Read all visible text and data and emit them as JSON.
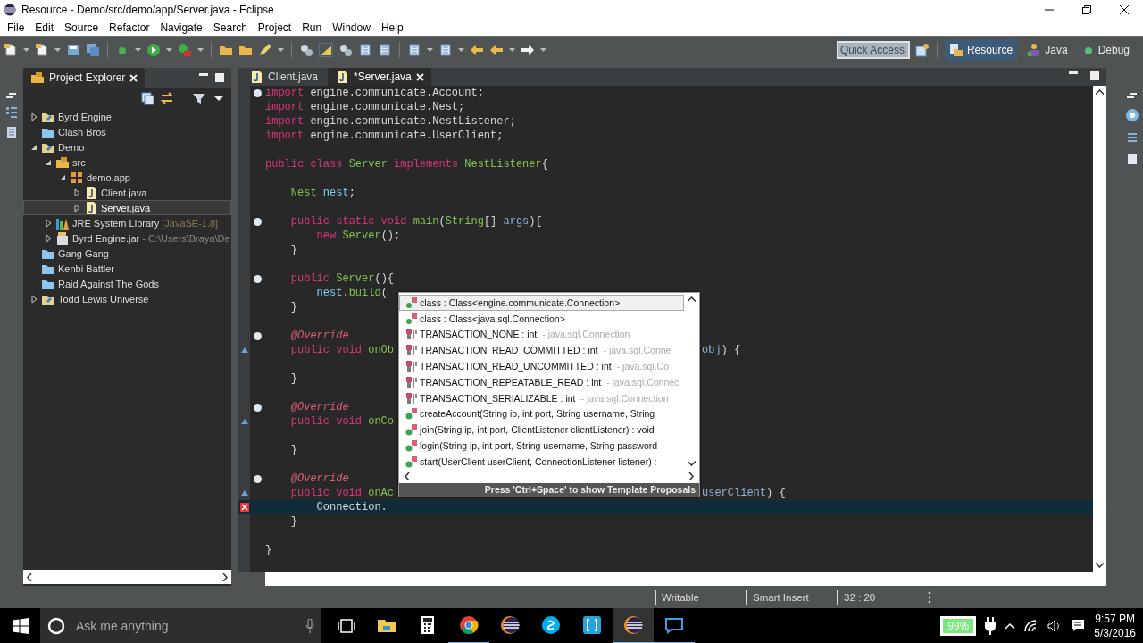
{
  "window": {
    "title": "Resource - Demo/src/demo/app/Server.java - Eclipse"
  },
  "menu": [
    "File",
    "Edit",
    "Source",
    "Refactor",
    "Navigate",
    "Search",
    "Project",
    "Run",
    "Window",
    "Help"
  ],
  "toolbar": {
    "quick_access": {
      "placeholder": "Quick Access"
    },
    "perspectives": [
      {
        "label": "Resource",
        "kind": "resource",
        "selected": true
      },
      {
        "label": "Java",
        "kind": "java",
        "selected": false
      },
      {
        "label": "Debug",
        "kind": "debug",
        "selected": false
      }
    ]
  },
  "project_explorer": {
    "title": "Project Explorer",
    "tree": [
      {
        "label": "Byrd Engine",
        "kind": "project",
        "expanded": false,
        "selected": false
      },
      {
        "label": "Clash Bros",
        "kind": "closed-project",
        "selected": false
      },
      {
        "label": "Demo",
        "kind": "project",
        "expanded": true,
        "selected": false,
        "children": [
          {
            "label": "src",
            "kind": "source-folder",
            "expanded": true,
            "selected": false,
            "children": [
              {
                "label": "demo.app",
                "kind": "package",
                "expanded": true,
                "selected": false,
                "children": [
                  {
                    "label": "Client.java",
                    "kind": "java",
                    "expanded": false,
                    "selected": false
                  },
                  {
                    "label": "Server.java",
                    "kind": "java",
                    "expanded": false,
                    "selected": true
                  }
                ]
              }
            ]
          },
          {
            "label": "JRE System Library",
            "decoration": "[JavaSE-1.8]",
            "kind": "library",
            "expanded": false,
            "selected": false
          },
          {
            "label": "Byrd Engine.jar",
            "decoration": "- C:\\Users\\Braya\\De",
            "kind": "jar",
            "expanded": false,
            "selected": false
          }
        ]
      },
      {
        "label": "Gang Gang",
        "kind": "closed-project",
        "selected": false
      },
      {
        "label": "Kenbi Battler",
        "kind": "closed-project",
        "selected": false
      },
      {
        "label": "Raid Against The Gods",
        "kind": "closed-project",
        "selected": false
      },
      {
        "label": "Todd Lewis Universe",
        "kind": "project",
        "expanded": false,
        "selected": false
      }
    ]
  },
  "editor": {
    "tabs": [
      {
        "label": "Client.java",
        "selected": false
      },
      {
        "label": "*Server.java",
        "selected": true
      }
    ],
    "lines": [
      {
        "kind": "code",
        "fold": true,
        "tokens": [
          {
            "kind": "kw",
            "text": "import"
          },
          {
            "kind": "plain",
            "text": " engine.communicate.Account;"
          }
        ]
      },
      {
        "kind": "code",
        "tokens": [
          {
            "kind": "kw",
            "text": "import"
          },
          {
            "kind": "plain",
            "text": " engine.communicate.Nest;"
          }
        ]
      },
      {
        "kind": "code",
        "tokens": [
          {
            "kind": "kw",
            "text": "import"
          },
          {
            "kind": "plain",
            "text": " engine.communicate.NestListener;"
          }
        ]
      },
      {
        "kind": "code",
        "tokens": [
          {
            "kind": "kw",
            "text": "import"
          },
          {
            "kind": "plain",
            "text": " engine.communicate.UserClient;"
          }
        ]
      },
      {
        "kind": "blank"
      },
      {
        "kind": "code",
        "tokens": [
          {
            "kind": "kw",
            "text": "public class "
          },
          {
            "kind": "type",
            "text": "Server"
          },
          {
            "kind": "kw",
            "text": " implements "
          },
          {
            "kind": "type",
            "text": "NestListener"
          },
          {
            "kind": "plain",
            "text": "{"
          }
        ]
      },
      {
        "kind": "blank"
      },
      {
        "kind": "code",
        "tokens": [
          {
            "kind": "type",
            "text": "    Nest"
          },
          {
            "kind": "field",
            "text": " nest"
          },
          {
            "kind": "plain",
            "text": ";"
          }
        ]
      },
      {
        "kind": "blank"
      },
      {
        "kind": "code",
        "fold": true,
        "tokens": [
          {
            "kind": "kw",
            "text": "    public static void "
          },
          {
            "kind": "method",
            "text": "main"
          },
          {
            "kind": "plain",
            "text": "("
          },
          {
            "kind": "type",
            "text": "String"
          },
          {
            "kind": "plain",
            "text": "[] "
          },
          {
            "kind": "param",
            "text": "args"
          },
          {
            "kind": "plain",
            "text": "){"
          }
        ]
      },
      {
        "kind": "code",
        "tokens": [
          {
            "kind": "kw",
            "text": "        new "
          },
          {
            "kind": "type",
            "text": "Server"
          },
          {
            "kind": "plain",
            "text": "();"
          }
        ]
      },
      {
        "kind": "code",
        "tokens": [
          {
            "kind": "plain",
            "text": "    }"
          }
        ]
      },
      {
        "kind": "blank"
      },
      {
        "kind": "code",
        "fold": true,
        "tokens": [
          {
            "kind": "kw",
            "text": "    public "
          },
          {
            "kind": "method",
            "text": "Server"
          },
          {
            "kind": "plain",
            "text": "(){"
          }
        ]
      },
      {
        "kind": "code",
        "tokens": [
          {
            "kind": "field",
            "text": "        nest"
          },
          {
            "kind": "plain",
            "text": "."
          },
          {
            "kind": "method",
            "text": "build"
          },
          {
            "kind": "plain",
            "text": "("
          }
        ]
      },
      {
        "kind": "code",
        "tokens": [
          {
            "kind": "plain",
            "text": "    }"
          }
        ]
      },
      {
        "kind": "blank"
      },
      {
        "kind": "code",
        "fold": true,
        "tokens": [
          {
            "kind": "ann",
            "text": "    @Override"
          }
        ]
      },
      {
        "kind": "code",
        "override_marker": true,
        "tokens": [
          {
            "kind": "kw",
            "text": "    public void "
          },
          {
            "kind": "method",
            "text": "onOb"
          }
        ],
        "tail": [
          {
            "kind": "param",
            "text": "obj"
          },
          {
            "kind": "plain",
            "text": ") {"
          }
        ]
      },
      {
        "kind": "blank"
      },
      {
        "kind": "code",
        "tokens": [
          {
            "kind": "plain",
            "text": "    }"
          }
        ]
      },
      {
        "kind": "blank"
      },
      {
        "kind": "code",
        "fold": true,
        "tokens": [
          {
            "kind": "ann",
            "text": "    @Override"
          }
        ]
      },
      {
        "kind": "code",
        "override_marker": true,
        "tokens": [
          {
            "kind": "kw",
            "text": "    public void "
          },
          {
            "kind": "method",
            "text": "onCo"
          }
        ]
      },
      {
        "kind": "blank"
      },
      {
        "kind": "code",
        "tokens": [
          {
            "kind": "plain",
            "text": "    }"
          }
        ]
      },
      {
        "kind": "blank"
      },
      {
        "kind": "code",
        "fold": true,
        "tokens": [
          {
            "kind": "ann",
            "text": "    @Override"
          }
        ]
      },
      {
        "kind": "code",
        "override_marker": true,
        "tokens": [
          {
            "kind": "kw",
            "text": "    public void "
          },
          {
            "kind": "method",
            "text": "onAc"
          }
        ],
        "tail": [
          {
            "kind": "param",
            "text": "userClient"
          },
          {
            "kind": "plain",
            "text": ") {"
          }
        ]
      },
      {
        "kind": "code",
        "error_marker": true,
        "current": true,
        "tokens": [
          {
            "kind": "plain",
            "text": "        Connection."
          }
        ]
      },
      {
        "kind": "code",
        "tokens": [
          {
            "kind": "plain",
            "text": "    }"
          }
        ]
      },
      {
        "kind": "blank"
      },
      {
        "kind": "code",
        "tokens": [
          {
            "kind": "plain",
            "text": "}"
          }
        ]
      }
    ],
    "autocomplete": {
      "items": [
        {
          "kind": "class-literal",
          "text": "class : Class<engine.communicate.Connection>",
          "selected": true
        },
        {
          "kind": "class-literal",
          "text": "class : Class<java.sql.Connection>",
          "selected": false
        },
        {
          "kind": "constant",
          "text": "TRANSACTION_NONE : int",
          "detail": "- java.sql.Connection",
          "selected": false
        },
        {
          "kind": "constant",
          "text": "TRANSACTION_READ_COMMITTED : int",
          "detail": "- java.sql.Conne",
          "selected": false
        },
        {
          "kind": "constant",
          "text": "TRANSACTION_READ_UNCOMMITTED : int",
          "detail": "- java.sql.Co",
          "selected": false
        },
        {
          "kind": "constant",
          "text": "TRANSACTION_REPEATABLE_READ : int",
          "detail": "- java.sql.Connec",
          "selected": false
        },
        {
          "kind": "constant",
          "text": "TRANSACTION_SERIALIZABLE : int",
          "detail": "- java.sql.Connection",
          "selected": false
        },
        {
          "kind": "method",
          "text": "createAccount(String ip, int port, String username, String",
          "selected": false
        },
        {
          "kind": "method",
          "text": "join(String ip, int port, ClientListener clientListener) : void",
          "selected": false
        },
        {
          "kind": "method",
          "text": "login(String ip, int port, String username, String password",
          "selected": false
        },
        {
          "kind": "method",
          "text": "start(UserClient userClient, ConnectionListener listener) :",
          "selected": false
        }
      ],
      "hint": "Press 'Ctrl+Space' to show Template Proposals"
    }
  },
  "status_bar": [
    "Writable",
    "Smart Insert",
    "32 : 20"
  ],
  "taskbar": {
    "search": {
      "placeholder": "Ask me anything"
    },
    "apps": [
      {
        "kind": "folder",
        "running": false,
        "selected": false
      },
      {
        "kind": "calculator",
        "running": false,
        "selected": false
      },
      {
        "kind": "browser",
        "running": true,
        "selected": false
      },
      {
        "kind": "ide",
        "running": false,
        "selected": false
      },
      {
        "kind": "chat",
        "running": false,
        "selected": false
      },
      {
        "kind": "brackets",
        "running": false,
        "selected": false
      },
      {
        "kind": "ide",
        "running": true,
        "selected": true
      },
      {
        "kind": "screen",
        "running": true,
        "selected": false
      }
    ],
    "battery": "99%",
    "time": "9:57 PM",
    "date": "5/3/2016"
  }
}
